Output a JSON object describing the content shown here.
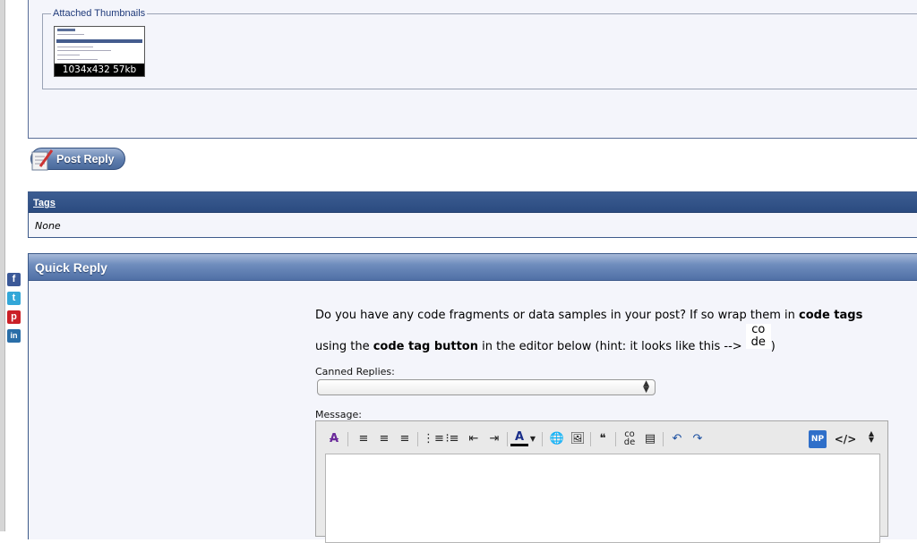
{
  "attachments": {
    "legend": "Attached Thumbnails",
    "thumbnail_caption": "1034x432 57kb"
  },
  "post_reply": {
    "label": "Post Reply"
  },
  "tags": {
    "heading": "Tags",
    "value": "None"
  },
  "social": [
    {
      "name": "facebook",
      "glyph": "f",
      "color": "#3b5998"
    },
    {
      "name": "twitter",
      "glyph": "t",
      "color": "#33a7d8"
    },
    {
      "name": "pinterest",
      "glyph": "p",
      "color": "#cb2027"
    },
    {
      "name": "linkedin",
      "glyph": "in",
      "color": "#2a6ea8"
    }
  ],
  "quick_reply": {
    "heading": "Quick Reply",
    "hint_line1_pre": "Do you have any code fragments or data samples in your post? If so wrap them in ",
    "hint_line1_bold": "code tags",
    "hint_line2_pre": "using the ",
    "hint_line2_bold": "code tag button",
    "hint_line2_post": " in the editor below (hint: it looks like this --> ",
    "hint_glyph_top": "co",
    "hint_glyph_bottom": "de",
    "hint_close": ")",
    "canned_label": "Canned Replies:",
    "message_label": "Message:"
  },
  "editor_toolbar": {
    "font_color_letter": "A",
    "code_top": "co",
    "code_bottom": "de",
    "np_badge": "NP",
    "source_toggle": "</>"
  }
}
